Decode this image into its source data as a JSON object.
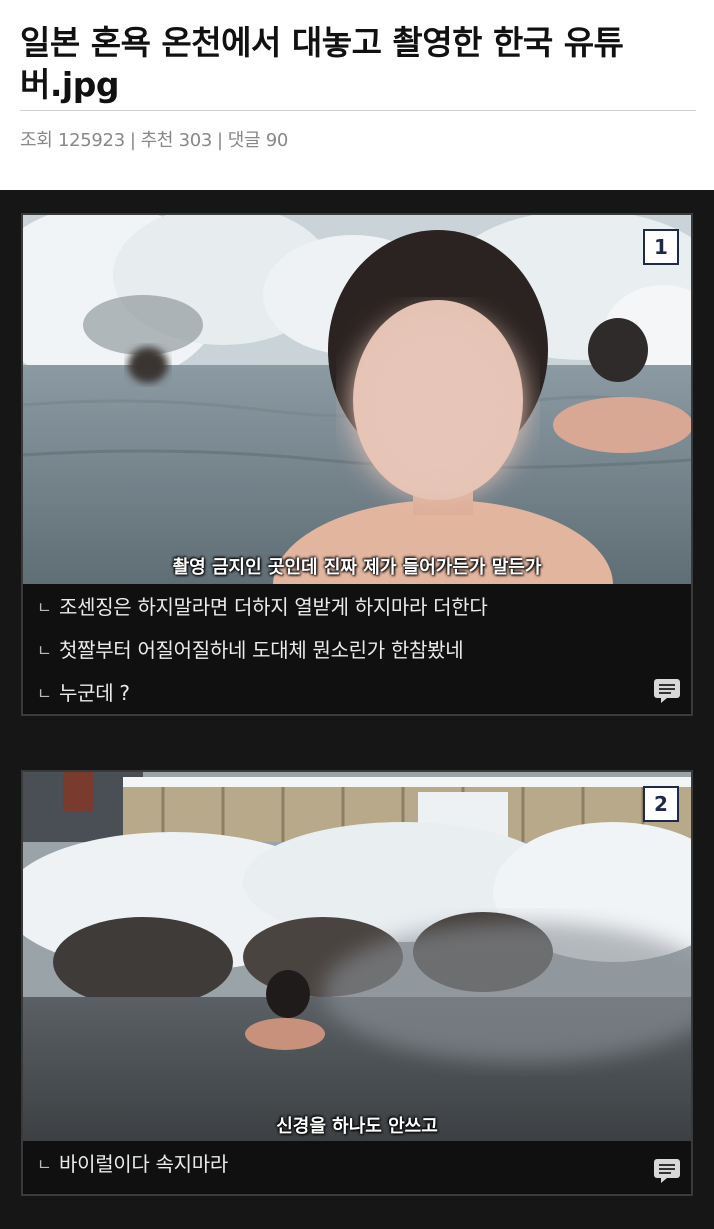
{
  "post": {
    "title": "일본 혼욕 온천에서 대놓고 촬영한 한국 유튜버.jpg",
    "views_label": "조회 125923",
    "recommend_label": "추천 303",
    "comments_label": "댓글 90",
    "separator": "|"
  },
  "cards": [
    {
      "badge": "1",
      "subtitle": "촬영 금지인 곳인데 진짜 제가 들어가든가 말든가",
      "comments": [
        "조센징은 하지말라면 더하지 열받게 하지마라 더한다",
        "첫짤부터 어질어질하네 도대체 뭔소린가 한참봤네",
        "누군데 ?"
      ]
    },
    {
      "badge": "2",
      "subtitle": "신경을 하나도 안쓰고",
      "comments": [
        "바이럴이다 속지마라"
      ]
    }
  ],
  "icons": {
    "comment_arrow": "ㄴ",
    "chat": "chat-bubble-icon"
  },
  "colors": {
    "background_dark": "#161616",
    "badge_border": "#1d2a4a",
    "meta_text": "#888888"
  }
}
